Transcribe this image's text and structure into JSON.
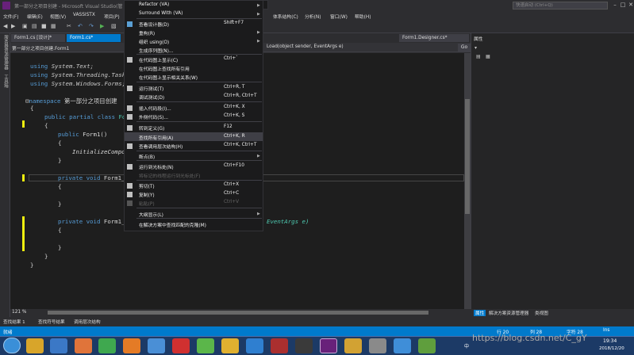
{
  "window": {
    "title": "第一部分之项目创建 - Microsoft Visual Studio(管",
    "quicklaunch_placeholder": "快速启动 (Ctrl+Q)"
  },
  "menu": {
    "items": [
      "文件(F)",
      "编辑(E)",
      "视图(V)",
      "VASSISTX",
      "项目(P)",
      "体系结构(C)",
      "分析(N)",
      "窗口(W)",
      "帮助(H)"
    ]
  },
  "left_strip": {
    "labels": [
      "服务器资源管理器",
      "工具箱"
    ]
  },
  "tabs": {
    "designer": "Form1.cs [设计]*",
    "code": "Form1.cs*",
    "form_designer": "Form1.Designer.cs*"
  },
  "navbar": {
    "left": "第一部分之项目创建.Form1",
    "right": "Load(object sender, EventArgs e)",
    "go": "Go"
  },
  "code": {
    "l_using1": "System.Text;",
    "l_using2": "System.Threading.Task",
    "l_using3": "System.Windows.Forms;",
    "l_ns": "第一部分之项目创建",
    "l_class_name": "Fo",
    "l_form1": "Form1()",
    "l_init": "InitializeCompo",
    "l_method1": "Form1_",
    "l_method2": "Form1_",
    "l_eventargs": "EventArgs e)"
  },
  "context_menu": {
    "refactor": "Refactor (VA)",
    "surround": "Surround With (VA)",
    "view_designer": "查看设计器(D)",
    "view_designer_sc": "Shift+F7",
    "refactor_cn": "重构(R)",
    "organize_usings": "组织 using(O)",
    "generate_sequence": "生成序列图(N)...",
    "show_in_code_map": "在代码图上显示(C)",
    "show_in_code_map_sc": "Ctrl+`",
    "find_all_refs_on_map": "在代码图上查找所有引用",
    "show_call_relation": "在代码图上显示相关关系(W)",
    "run_tests": "运行测试(T)",
    "run_tests_sc": "Ctrl+R, T",
    "debug_tests": "调试测试(D)",
    "debug_tests_sc": "Ctrl+R, Ctrl+T",
    "insert_snippet": "插入代码段(I)...",
    "insert_snippet_sc": "Ctrl+K, X",
    "surround_with": "外侧代码(S)...",
    "surround_with_sc": "Ctrl+K, S",
    "goto_definition": "转到定义(G)",
    "goto_definition_sc": "F12",
    "find_all_refs": "查找所有引用(A)",
    "find_all_refs_sc": "Ctrl+K, R",
    "view_call_hierarchy": "查看调用层次结构(H)",
    "view_call_hierarchy_sc": "Ctrl+K, Ctrl+T",
    "breakpoint": "断点(B)",
    "run_to_cursor": "运行到光标处(N)",
    "run_to_cursor_sc": "Ctrl+F10",
    "run_flagged": "将标记的线程运行到光标处(F)",
    "cut": "剪切(T)",
    "cut_sc": "Ctrl+X",
    "copy": "复制(Y)",
    "copy_sc": "Ctrl+C",
    "paste": "粘贴(P)",
    "paste_sc": "Ctrl+V",
    "outlining": "大纲显示(L)",
    "find_matching_clone": "在解决方案中查找匹配的克隆(M)",
    "submenu_arrow": "▶"
  },
  "editor_footer": {
    "zoom": "121 %"
  },
  "right_panel": {
    "title": "属性",
    "tabs": [
      "属性",
      "解决方案资源管理器",
      "类视图"
    ]
  },
  "bottom_tabs": [
    "查找结果 1",
    "查找符号结果",
    "调用层次结构"
  ],
  "status": {
    "left": "就绪",
    "line": "行 20",
    "col": "列 28",
    "ch": "字符 28",
    "ins": "Ins"
  },
  "taskbar": {
    "time": "19:34",
    "date": "2018/12/20",
    "tray_lang": "中",
    "watermark": "https://blog.csdn.net/C_gY"
  },
  "colors": {
    "accent": "#007acc",
    "keyword": "#569cd6",
    "type": "#4ec9b0",
    "editor_bg": "#1e1e1e",
    "menu_bg": "#1b1b1c"
  },
  "icons": {
    "start": "windows-start-icon",
    "app": "visual-studio-icon"
  }
}
